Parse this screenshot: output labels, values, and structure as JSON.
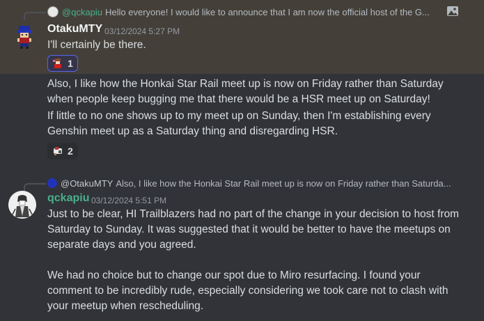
{
  "messages": [
    {
      "reply": {
        "author": "@qckapiu",
        "text": "Hello everyone! I would like to announce that I am now the official host of the G...",
        "has_image_icon": true
      },
      "author": "OtakuMTY",
      "timestamp": "03/12/2024 5:27 PM",
      "author_color": "#f2f3f5",
      "highlighted": true,
      "content": [
        "I'll certainly be there."
      ],
      "reaction": {
        "emoji": "character-icon",
        "count": "1",
        "active": true
      }
    },
    {
      "continued": true,
      "content": [
        "Also, I like how the Honkai Star Rail meet up is now on Friday rather than Saturday\nwhen people keep bugging me that there would be a HSR meet up on Saturday!",
        "If little to no one shows up to my meet up on Sunday, then I'm establishing every\nGenshin meet up as a Saturday thing and disregarding HSR."
      ],
      "reaction": {
        "emoji": "character-icon",
        "count": "2",
        "active": false
      }
    },
    {
      "reply": {
        "author": "@OtakuMTY",
        "text": "Also, I like how the Honkai Star Rail meet up is now on Friday rather than Saturda..."
      },
      "author": "qckapiu",
      "timestamp": "03/12/2024 5:51 PM",
      "author_color": "#49b08a",
      "content": [
        "Just to be clear, HI Trailblazers had no part of the change in your decision to host from\nSaturday to Sunday. It was suggested that it would be better to have the meetups on\nseparate days and you agreed.\n\nWe had no choice but to change our spot due to Miro resurfacing. I found your\ncomment to be incredibly rude, especially considering we took care not to clash with\nyour meetup when rescheduling."
      ]
    }
  ]
}
